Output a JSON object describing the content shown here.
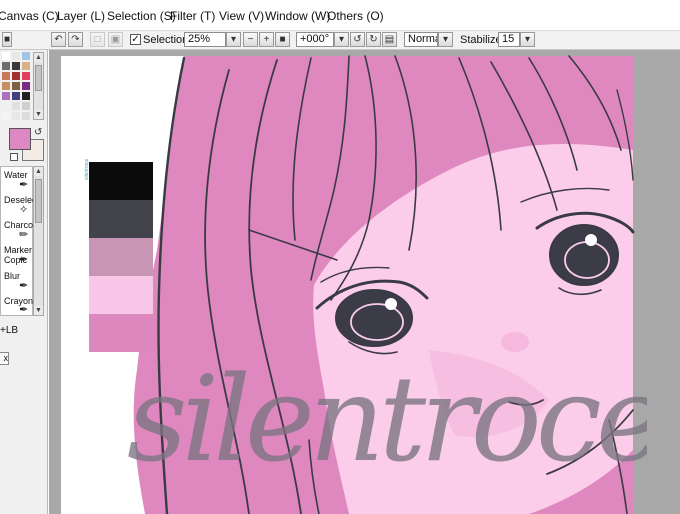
{
  "menu": {
    "canvas": "Canvas (C)",
    "layer": "Layer (L)",
    "selection": "Selection (S)",
    "filter": "Filter (T)",
    "view": "View (V)",
    "window": "Window (W)",
    "others": "Others (O)"
  },
  "toolbar": {
    "selection_label": "Selection",
    "zoom_value": "25%",
    "rotation_value": "+000°",
    "blend_mode": "Normal",
    "stabilizer_label": "Stabilizer",
    "stabilizer_value": "15"
  },
  "tools": {
    "water": "Water",
    "deselect": "Deselect",
    "charcoal": "Charcoal",
    "marker": "Marker",
    "copic": "Copic",
    "blur": "Blur",
    "crayon": "Crayon"
  },
  "left_panel": {
    "shortcut_text": "+LB",
    "cut_label": "x"
  },
  "canvas": {
    "palette_colors": [
      "#0b0b0b",
      "#43434c",
      "#c896b4",
      "#f8c6e6",
      "#dc88bf"
    ],
    "palette_caption": "silentroce",
    "signature": "silentroce"
  },
  "colors": {
    "hair": "#df88c0",
    "skin": "#fbcdeb",
    "lineart": "#3a3a44",
    "eye_dark": "#3b3c47",
    "primary_color": "#dd88c2",
    "secondary_color": "#f3ece6"
  }
}
